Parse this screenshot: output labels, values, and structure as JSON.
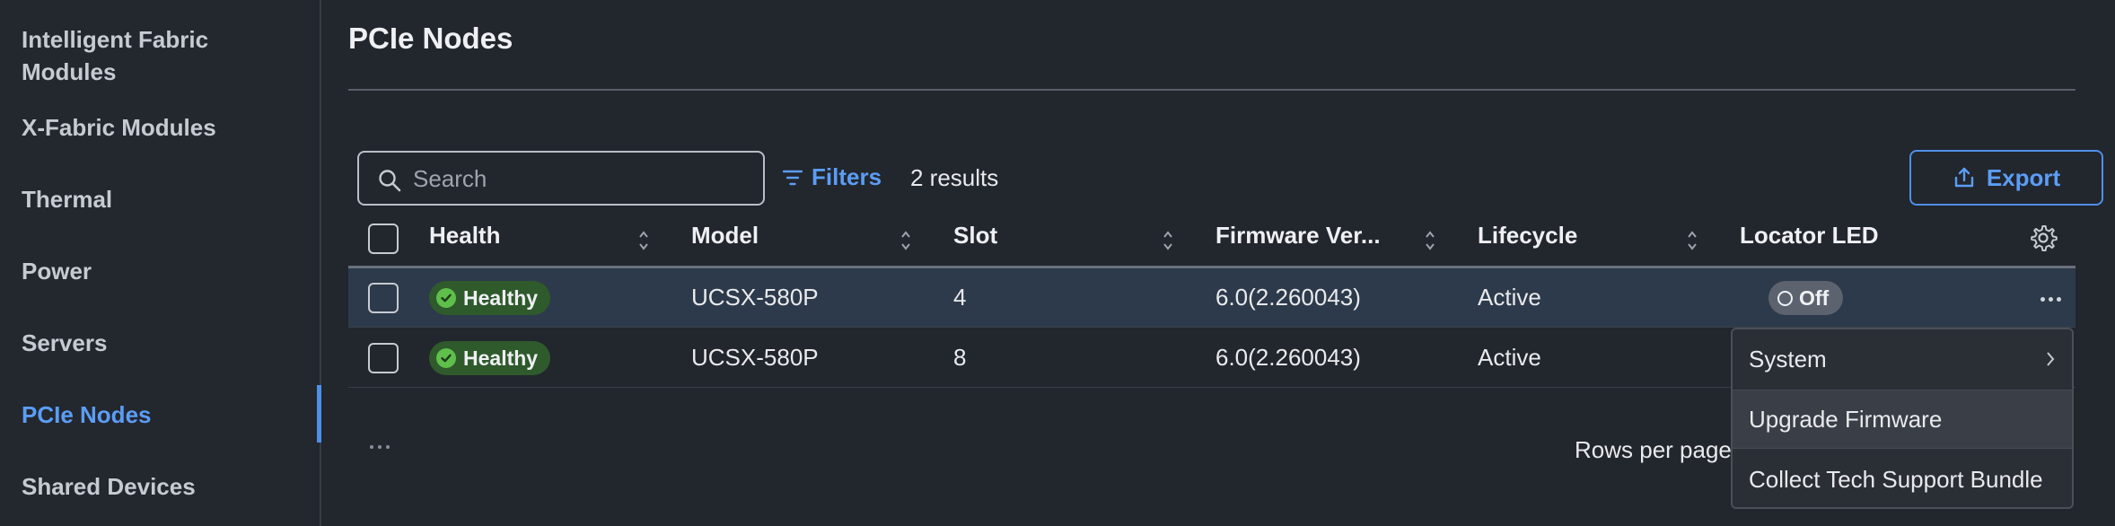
{
  "sidebar": {
    "items": [
      {
        "label_line1": "Intelligent Fabric",
        "label_line2": "Modules"
      },
      {
        "label": "X-Fabric Modules"
      },
      {
        "label": "Thermal"
      },
      {
        "label": "Power"
      },
      {
        "label": "Servers"
      },
      {
        "label": "PCIe Nodes",
        "active": true
      },
      {
        "label": "Shared Devices"
      }
    ]
  },
  "main": {
    "title": "PCIe Nodes",
    "toolbar": {
      "search_placeholder": "Search",
      "filters_label": "Filters",
      "results_text": "2 results",
      "export_label": "Export"
    },
    "table": {
      "columns": [
        "Health",
        "Model",
        "Slot",
        "Firmware Ver...",
        "Lifecycle",
        "Locator LED"
      ],
      "rows": [
        {
          "health": "Healthy",
          "model": "UCSX-580P",
          "slot": "4",
          "firmware": "6.0(2.260043)",
          "lifecycle": "Active",
          "locator_led": "Off"
        },
        {
          "health": "Healthy",
          "model": "UCSX-580P",
          "slot": "8",
          "firmware": "6.0(2.260043)",
          "lifecycle": "Active",
          "locator_led": ""
        }
      ]
    },
    "footer": {
      "rows_per_page_label": "Rows per page"
    }
  },
  "context_menu": {
    "items": [
      "System",
      "Upgrade Firmware",
      "Collect Tech Support Bundle"
    ]
  },
  "colors": {
    "accent": "#5b9df5",
    "healthy": "#5fbf4b",
    "background": "#22262d",
    "selected_row": "#2d3a4b"
  }
}
